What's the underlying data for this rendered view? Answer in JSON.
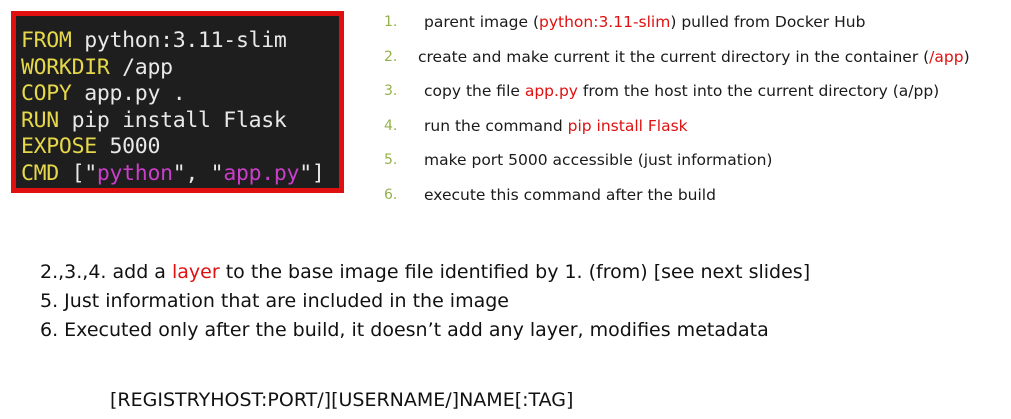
{
  "dockerfile": {
    "lines": [
      {
        "kw": "FROM",
        "rest": " python:3.11-slim"
      },
      {
        "kw": "WORKDIR",
        "rest": " /app"
      },
      {
        "kw": "COPY",
        "rest": " app.py ."
      },
      {
        "kw": "RUN",
        "rest": " pip install Flask"
      },
      {
        "kw": "EXPOSE",
        "rest": " 5000"
      },
      {
        "kw": "CMD",
        "rest1": " [\"",
        "str1": "python",
        "rest2": "\", \"",
        "str2": "app.py",
        "rest3": "\"]"
      }
    ]
  },
  "steps": [
    {
      "num": "1.",
      "pre": "parent image (",
      "hl": "python:3.11-slim",
      "post": ") pulled from Docker Hub"
    },
    {
      "num": "2.",
      "pre": "create and make current it the current directory in the container (",
      "hl": "/app",
      "post": ")"
    },
    {
      "num": "3.",
      "pre": "copy the file ",
      "hl": "app.py",
      "post": " from the host into the current directory (a/pp)"
    },
    {
      "num": "4.",
      "pre": "run the ",
      "mid": "command",
      "hl": "pip install Flask",
      "post": ""
    },
    {
      "num": "5.",
      "pre": "make port 5000 accessible (just information)",
      "hl": "",
      "post": ""
    },
    {
      "num": "6.",
      "pre": "execute this command after the build",
      "hl": "",
      "post": ""
    }
  ],
  "notes": {
    "n1_pre": "2.,3.,4. add a ",
    "n1_hl": "layer",
    "n1_post": " to the base image file identified by 1. (from) [see next slides]",
    "n2": "5. Just information that are included in the image",
    "n3": "6. Executed only after the build, it doesn’t add any layer, modifies metadata"
  },
  "format": "[REGISTRYHOST:PORT/][USERNAME/]NAME[:TAG]",
  "colors": {
    "border": "#e01010",
    "highlight": "#e01010",
    "keyword": "#e6d84a",
    "string": "#c93fc9",
    "numbers": "#93b24a"
  }
}
